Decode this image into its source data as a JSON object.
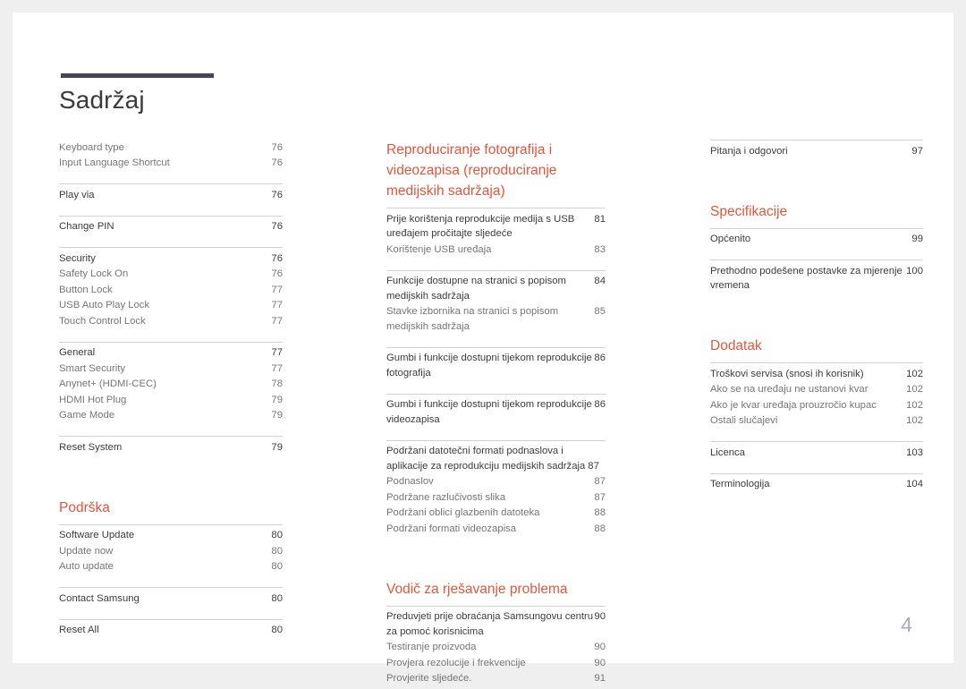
{
  "document": {
    "title": "Sadržaj",
    "page_number": "4",
    "accent_color": "#e0573b",
    "rule_color": "#474359"
  },
  "columns": [
    {
      "id": "column-1",
      "blocks": [
        {
          "type": "group",
          "rule": false,
          "entries": [
            {
              "level": 2,
              "label": "Keyboard type",
              "page": "76"
            },
            {
              "level": 2,
              "label": "Input Language Shortcut",
              "page": "76"
            }
          ]
        },
        {
          "type": "group",
          "rule": true,
          "entries": [
            {
              "level": 1,
              "label": "Play via",
              "page": "76"
            }
          ]
        },
        {
          "type": "group",
          "rule": true,
          "entries": [
            {
              "level": 1,
              "label": "Change PIN",
              "page": "76"
            }
          ]
        },
        {
          "type": "group",
          "rule": true,
          "entries": [
            {
              "level": 1,
              "label": "Security",
              "page": "76"
            },
            {
              "level": 2,
              "label": "Safety Lock On",
              "page": "76"
            },
            {
              "level": 2,
              "label": "Button Lock",
              "page": "77"
            },
            {
              "level": 2,
              "label": "USB Auto Play Lock",
              "page": "77"
            },
            {
              "level": 2,
              "label": "Touch Control Lock",
              "page": "77"
            }
          ]
        },
        {
          "type": "group",
          "rule": true,
          "entries": [
            {
              "level": 1,
              "label": "General",
              "page": "77"
            },
            {
              "level": 2,
              "label": "Smart Security",
              "page": "77"
            },
            {
              "level": 2,
              "label": "Anynet+ (HDMI-CEC)",
              "page": "78"
            },
            {
              "level": 2,
              "label": "HDMI Hot Plug",
              "page": "79"
            },
            {
              "level": 2,
              "label": "Game Mode",
              "page": "79"
            }
          ]
        },
        {
          "type": "group",
          "rule": true,
          "entries": [
            {
              "level": 1,
              "label": "Reset System",
              "page": "79"
            }
          ]
        },
        {
          "type": "heading",
          "label": "Podrška"
        },
        {
          "type": "group",
          "rule": true,
          "entries": [
            {
              "level": 1,
              "label": "Software Update",
              "page": "80"
            },
            {
              "level": 2,
              "label": "Update now",
              "page": "80"
            },
            {
              "level": 2,
              "label": "Auto update",
              "page": "80"
            }
          ]
        },
        {
          "type": "group",
          "rule": true,
          "entries": [
            {
              "level": 1,
              "label": "Contact Samsung",
              "page": "80"
            }
          ]
        },
        {
          "type": "group",
          "rule": true,
          "entries": [
            {
              "level": 1,
              "label": "Reset All",
              "page": "80"
            }
          ]
        }
      ]
    },
    {
      "id": "column-2",
      "blocks": [
        {
          "type": "heading",
          "label": "Reproduciranje fotografija i videozapisa (reproduciranje medijskih sadržaja)"
        },
        {
          "type": "group",
          "rule": true,
          "entries": [
            {
              "level": 1,
              "label": "Prije korištenja reprodukcije medija s USB uređajem pročitajte sljedeće",
              "page": "81",
              "wrap": true
            },
            {
              "level": 2,
              "label": "Korištenje USB uređaja",
              "page": "83"
            }
          ]
        },
        {
          "type": "group",
          "rule": true,
          "entries": [
            {
              "level": 1,
              "label": "Funkcije dostupne na stranici s popisom medijskih sadržaja",
              "page": "84",
              "wrap": true
            },
            {
              "level": 2,
              "label": "Stavke izbornika na stranici s popisom medijskih sadržaja",
              "page": "85",
              "wrap": true
            }
          ]
        },
        {
          "type": "group",
          "rule": true,
          "entries": [
            {
              "level": 1,
              "label": "Gumbi i funkcije dostupni tijekom reprodukcije fotografija",
              "page": "86",
              "wrap": true
            }
          ]
        },
        {
          "type": "group",
          "rule": true,
          "entries": [
            {
              "level": 1,
              "label": "Gumbi i funkcije dostupni tijekom reprodukcije videozapisa",
              "page": "86",
              "wrap": true
            }
          ]
        },
        {
          "type": "group",
          "rule": true,
          "entries": [
            {
              "level": 1,
              "label": "Podržani datotečni formati podnaslova i aplikacije za reprodukciju medijskih sadržaja",
              "page": "87",
              "wrap": true,
              "inline_num": true
            },
            {
              "level": 2,
              "label": "Podnaslov",
              "page": "87"
            },
            {
              "level": 2,
              "label": "Podržane razlučivosti slika",
              "page": "87"
            },
            {
              "level": 2,
              "label": "Podržani oblici glazbenih datoteka",
              "page": "88"
            },
            {
              "level": 2,
              "label": "Podržani formati videozapisa",
              "page": "88"
            }
          ]
        },
        {
          "type": "heading",
          "label": "Vodič za rješavanje problema"
        },
        {
          "type": "group",
          "rule": true,
          "entries": [
            {
              "level": 1,
              "label": "Preduvjeti prije obraćanja Samsungovu centru za pomoć korisnicima",
              "page": "90",
              "wrap": true
            },
            {
              "level": 2,
              "label": "Testiranje proizvoda",
              "page": "90"
            },
            {
              "level": 2,
              "label": "Provjera rezolucije i frekvencije",
              "page": "90"
            },
            {
              "level": 2,
              "label": "Provjerite sljedeće.",
              "page": "91"
            }
          ]
        }
      ]
    },
    {
      "id": "column-3",
      "blocks": [
        {
          "type": "group",
          "rule": true,
          "entries": [
            {
              "level": 1,
              "label": "Pitanja i odgovori",
              "page": "97"
            }
          ]
        },
        {
          "type": "heading",
          "label": "Specifikacije"
        },
        {
          "type": "group",
          "rule": true,
          "entries": [
            {
              "level": 1,
              "label": "Općenito",
              "page": "99"
            }
          ]
        },
        {
          "type": "group",
          "rule": true,
          "entries": [
            {
              "level": 1,
              "label": "Prethodno podešene postavke za mjerenje vremena",
              "page": "100",
              "wrap": true
            }
          ]
        },
        {
          "type": "heading",
          "label": "Dodatak"
        },
        {
          "type": "group",
          "rule": true,
          "entries": [
            {
              "level": 1,
              "label": "Troškovi servisa (snosi ih korisnik)",
              "page": "102"
            },
            {
              "level": 2,
              "label": "Ako se na uređaju ne ustanovi kvar",
              "page": "102"
            },
            {
              "level": 2,
              "label": "Ako je kvar uređaja prouzročio kupac",
              "page": "102"
            },
            {
              "level": 2,
              "label": "Ostali slučajevi",
              "page": "102"
            }
          ]
        },
        {
          "type": "group",
          "rule": true,
          "entries": [
            {
              "level": 1,
              "label": "Licenca",
              "page": "103"
            }
          ]
        },
        {
          "type": "group",
          "rule": true,
          "entries": [
            {
              "level": 1,
              "label": "Terminologija",
              "page": "104"
            }
          ]
        }
      ]
    }
  ]
}
